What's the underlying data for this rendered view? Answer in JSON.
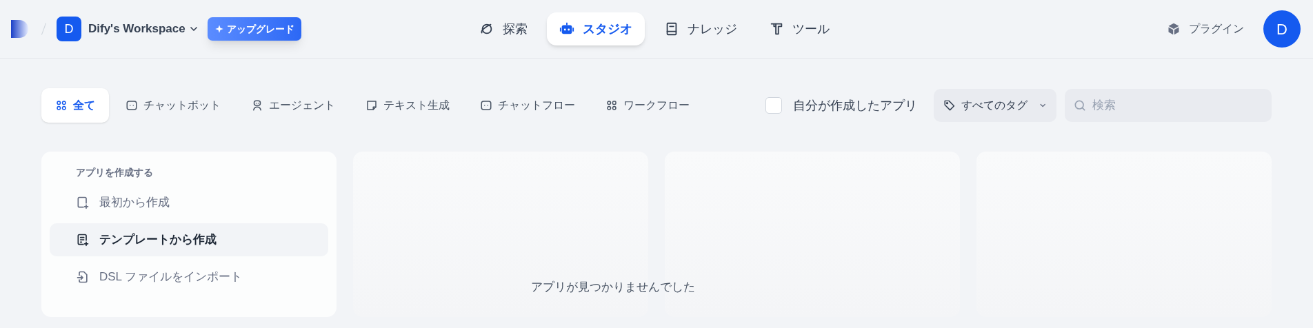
{
  "header": {
    "workspace": {
      "initial": "D",
      "name": "Dify's Workspace"
    },
    "upgrade_button": "アップグレード",
    "nav": [
      {
        "kind": "explore",
        "label": "探索",
        "selected": false
      },
      {
        "kind": "studio",
        "label": "スタジオ",
        "selected": true
      },
      {
        "kind": "knowledge",
        "label": "ナレッジ",
        "selected": false
      },
      {
        "kind": "tools",
        "label": "ツール",
        "selected": false
      }
    ],
    "plugins": "プラグイン",
    "avatar": "D"
  },
  "filters": {
    "tabs": [
      {
        "kind": "all",
        "label": "全て",
        "selected": true
      },
      {
        "kind": "chat",
        "label": "チャットボット",
        "selected": false
      },
      {
        "kind": "agent",
        "label": "エージェント",
        "selected": false
      },
      {
        "kind": "text",
        "label": "テキスト生成",
        "selected": false
      },
      {
        "kind": "chat",
        "label": "チャットフロー",
        "selected": false
      },
      {
        "kind": "workflow",
        "label": "ワークフロー",
        "selected": false
      }
    ],
    "mine_checkbox": {
      "label": "自分が作成したアプリ",
      "checked": false
    },
    "tag_dropdown": "すべてのタグ",
    "search": {
      "placeholder": "検索"
    }
  },
  "create_card": {
    "heading": "アプリを作成する",
    "items": [
      {
        "kind": "blank",
        "label": "最初から作成",
        "highlighted": false
      },
      {
        "kind": "template",
        "label": "テンプレートから作成",
        "highlighted": true
      },
      {
        "kind": "import",
        "label": "DSL ファイルをインポート",
        "highlighted": false
      }
    ]
  },
  "empty_message": "アプリが見つかりませんでした"
}
